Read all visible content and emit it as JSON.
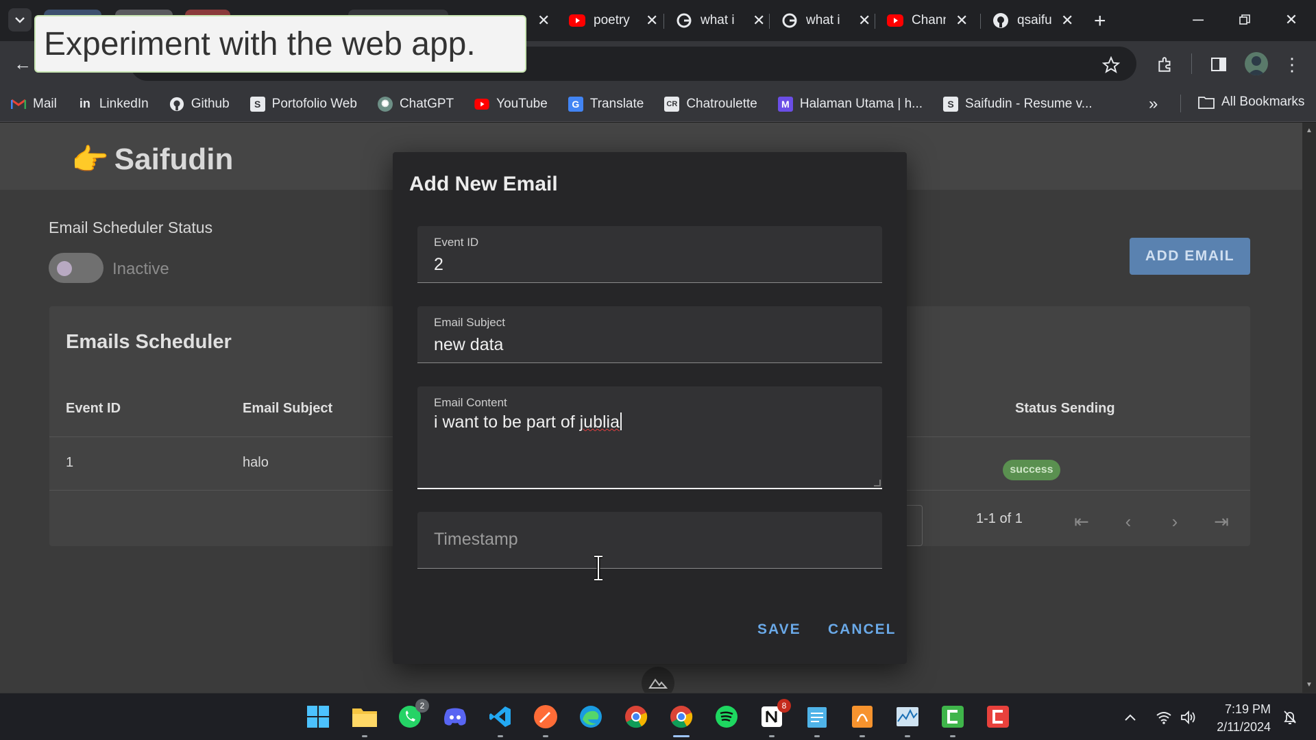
{
  "tooltip": {
    "text": "Experiment with the web app."
  },
  "tabs": [
    {
      "title": "poetry",
      "icon": "youtube-icon"
    },
    {
      "title": "what i",
      "icon": "google-icon"
    },
    {
      "title": "what i",
      "icon": "google-icon"
    },
    {
      "title": "Channel",
      "icon": "youtube-icon"
    },
    {
      "title": "qsaifu",
      "icon": "github-icon"
    }
  ],
  "bookmarks": [
    {
      "label": "Mail",
      "icon": "gmail-icon"
    },
    {
      "label": "LinkedIn",
      "icon": "linkedin-icon"
    },
    {
      "label": "Github",
      "icon": "github-icon"
    },
    {
      "label": "Portofolio Web",
      "icon": "s-icon"
    },
    {
      "label": "ChatGPT",
      "icon": "chatgpt-icon"
    },
    {
      "label": "YouTube",
      "icon": "youtube-icon"
    },
    {
      "label": "Translate",
      "icon": "translate-icon"
    },
    {
      "label": "Chatroulette",
      "icon": "cr-icon"
    },
    {
      "label": "Halaman Utama | h...",
      "icon": "halaman-icon"
    },
    {
      "label": "Saifudin - Resume v...",
      "icon": "s-icon"
    }
  ],
  "bookmarks_all": "All Bookmarks",
  "app": {
    "logo_text": "Saifudin",
    "scheduler_status_label": "Email Scheduler Status",
    "switch_label": "Inactive",
    "add_email_label": "ADD EMAIL",
    "table_title": "Emails Scheduler",
    "columns": {
      "event_id": "Event ID",
      "email_subject": "Email Subject",
      "status_sending": "Status Sending"
    },
    "rows": [
      {
        "event_id": "1",
        "email_subject": "halo",
        "status": "success"
      }
    ],
    "pagination": "1-1 of 1"
  },
  "dialog": {
    "title": "Add New Email",
    "event_id": {
      "label": "Event ID",
      "value": "2"
    },
    "email_subject": {
      "label": "Email Subject",
      "value": "new data"
    },
    "email_content": {
      "label": "Email Content",
      "value_prefix": "i want to be part of ",
      "value_misspelled": "jublia"
    },
    "timestamp": {
      "placeholder": "Timestamp"
    },
    "save_label": "SAVE",
    "cancel_label": "CANCEL"
  },
  "taskbar": {
    "whatsapp_badge": "2",
    "notion_badge": "8",
    "time": "7:19 PM",
    "date": "2/11/2024"
  },
  "colors": {
    "accent": "#6aa9e8",
    "success": "#5a9050",
    "dialog_bg": "#262628"
  }
}
